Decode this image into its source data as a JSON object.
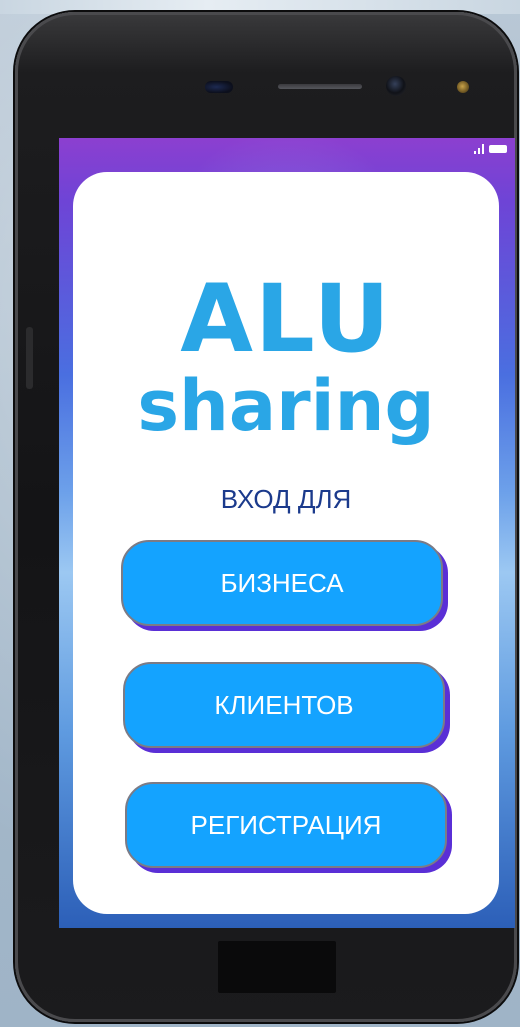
{
  "app": {
    "title_line1": "ALU",
    "title_line2": "sharing",
    "subtitle": "ВХОД ДЛЯ"
  },
  "buttons": [
    {
      "label": "БИЗНЕСА"
    },
    {
      "label": "КЛИЕНТОВ"
    },
    {
      "label": "РЕГИСТРАЦИЯ"
    }
  ],
  "status_bar": {
    "icons": [
      "signal-icon",
      "battery-icon"
    ]
  },
  "colors": {
    "title": "#2aa6e6",
    "subtitle": "#1b3a8c",
    "button_fill": "#14a3ff",
    "button_shadow": "#5a2fd6",
    "card": "#ffffff"
  }
}
